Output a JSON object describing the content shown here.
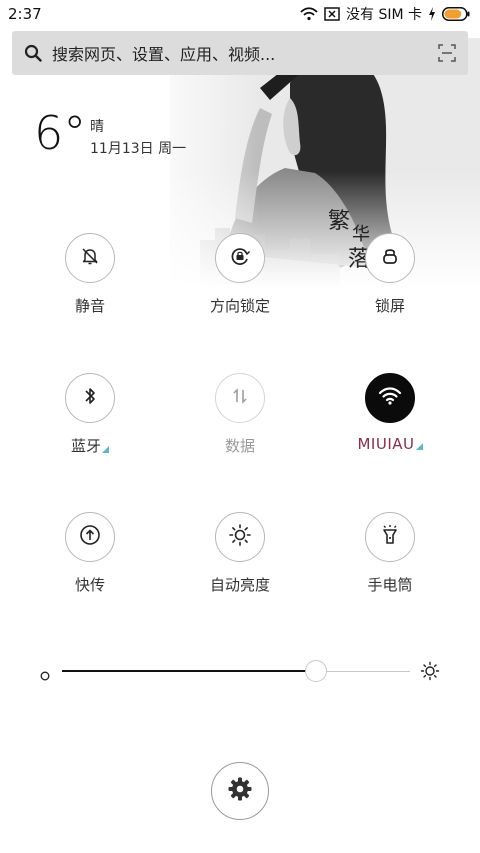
{
  "status_bar": {
    "time": "2:37",
    "sim_text": "没有 SIM 卡",
    "icons": [
      "wifi-icon",
      "no-sim-icon",
      "charging-icon",
      "battery-icon"
    ],
    "battery_level": 0.8,
    "battery_color": "#f0a030"
  },
  "search": {
    "placeholder": "搜索网页、设置、应用、视频..."
  },
  "wallpaper": {
    "calligraphy": [
      "繁",
      "华",
      "落"
    ]
  },
  "weather": {
    "temperature": "6°",
    "condition": "晴",
    "date": "11月13日 周一"
  },
  "toggles": [
    {
      "label": "静音",
      "icon": "silent-bell-icon",
      "state": "off"
    },
    {
      "label": "方向锁定",
      "icon": "rotation-lock-icon",
      "state": "off"
    },
    {
      "label": "锁屏",
      "icon": "lock-icon",
      "state": "off"
    },
    {
      "label": "蓝牙",
      "icon": "bluetooth-icon",
      "state": "off",
      "has_submenu": true
    },
    {
      "label": "数据",
      "icon": "mobile-data-icon",
      "state": "disabled"
    },
    {
      "label": "MIUIAU",
      "icon": "wifi-icon",
      "state": "on",
      "has_submenu": true
    },
    {
      "label": "快传",
      "icon": "quick-transfer-icon",
      "state": "off"
    },
    {
      "label": "自动亮度",
      "icon": "auto-brightness-icon",
      "state": "off"
    },
    {
      "label": "手电筒",
      "icon": "flashlight-icon",
      "state": "off"
    }
  ],
  "brightness": {
    "level": 0.73,
    "icons": [
      "brightness-low-icon",
      "brightness-high-icon"
    ]
  },
  "settings": {
    "icon": "gear-icon"
  },
  "colors": {
    "active_toggle": "#0b0b0b",
    "wifi_label": "#8a2f4a",
    "submenu_marker": "#5fb8c8"
  }
}
